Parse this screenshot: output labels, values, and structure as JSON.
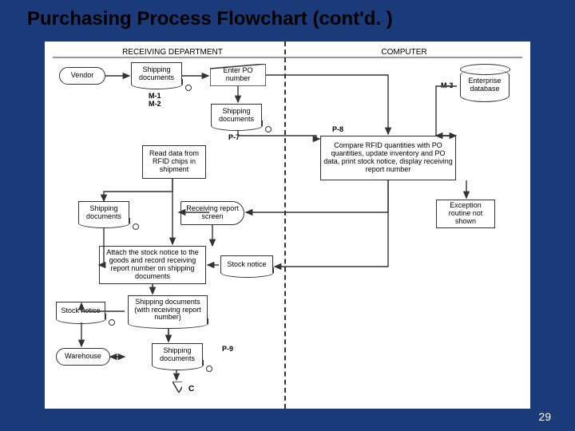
{
  "title": "Purchasing Process Flowchart (cont'd. )",
  "page_number": "29",
  "headers": {
    "receiving": "RECEIVING DEPARTMENT",
    "computer": "COMPUTER"
  },
  "nodes": {
    "vendor": "Vendor",
    "ship_docs1": "Shipping documents",
    "enter_po": "Enter PO number",
    "enterprise_db": "Enterprise database",
    "ship_docs2": "Shipping documents",
    "compare": "Compare RFID quantities with PO quantities, update inventory and PO data, print stock notice, display receiving report number",
    "read_rfid": "Read data from RFID chips in shipment",
    "ship_docs3": "Shipping documents",
    "recv_screen": "Receiving report screen",
    "exception": "Exception routine not shown",
    "attach": "Attach the stock notice to the goods and record receiving report number on shipping documents",
    "stock_notice2": "Stock notice",
    "stock_notice1": "Stock notice",
    "ship_docs4": "Shipping documents (with receiving report number)",
    "warehouse": "Warehouse",
    "ship_docs5": "Shipping documents"
  },
  "labels": {
    "m1": "M-1",
    "m2": "M-2",
    "m3": "M-3",
    "p7": "P-7",
    "p8": "P-8",
    "p9": "P-9",
    "c": "C"
  }
}
